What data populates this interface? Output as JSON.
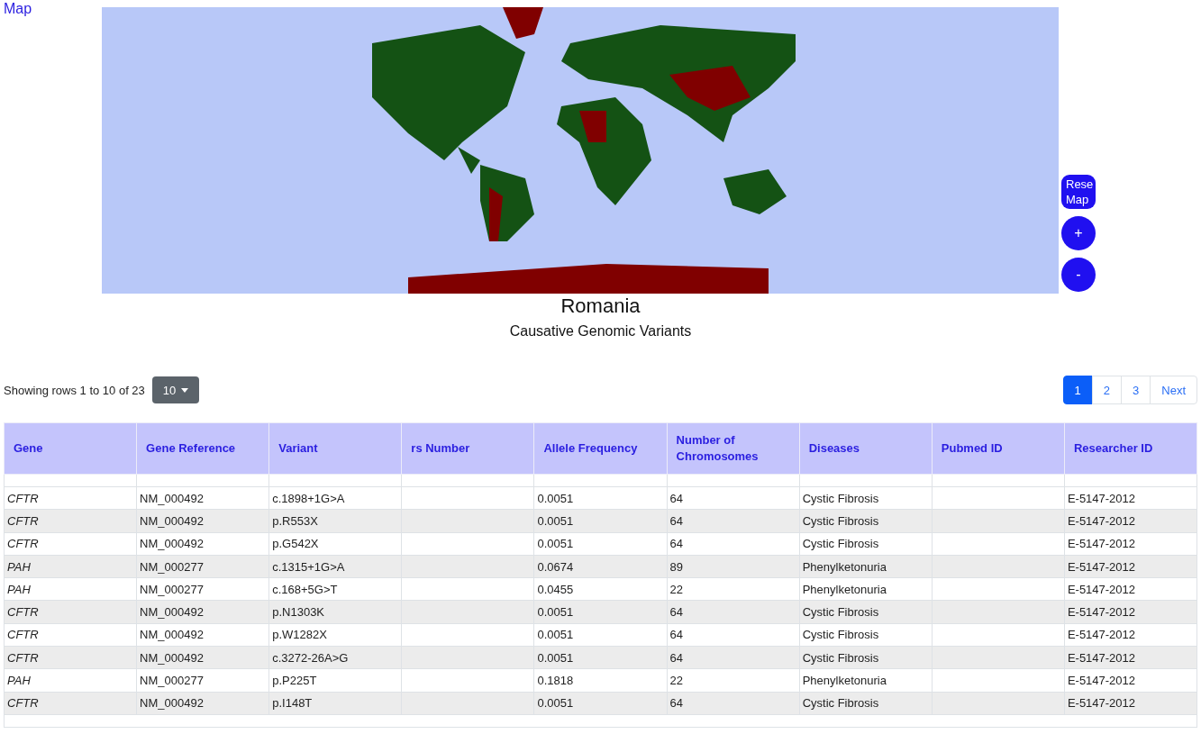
{
  "header": {
    "link": "Map"
  },
  "map": {
    "controls": [
      {
        "kind": "text",
        "label": "Rese Map"
      },
      {
        "kind": "round",
        "label": "+"
      },
      {
        "kind": "round",
        "label": "-"
      }
    ]
  },
  "title": "Romania",
  "subtitle": "Causative Genomic Variants",
  "toolbar": {
    "summary": "Showing rows 1 to 10 of 23",
    "page_size": "10"
  },
  "pagination": [
    {
      "label": "1",
      "selected": true
    },
    {
      "label": "2",
      "selected": false
    },
    {
      "label": "3",
      "selected": false
    },
    {
      "label": "Next",
      "selected": false
    }
  ],
  "table": {
    "columns": [
      {
        "label": "Gene",
        "kind": "gene"
      },
      {
        "label": "Gene Reference",
        "kind": "text"
      },
      {
        "label": "Variant",
        "kind": "text"
      },
      {
        "label": "rs Number",
        "kind": "text"
      },
      {
        "label": "Allele Frequency",
        "kind": "text"
      },
      {
        "label": "Number of Chromosomes",
        "kind": "text"
      },
      {
        "label": "Diseases",
        "kind": "text"
      },
      {
        "label": "Pubmed ID",
        "kind": "text"
      },
      {
        "label": "Researcher ID",
        "kind": "text"
      }
    ],
    "rows": [
      [
        "CFTR",
        "NM_000492",
        "c.1898+1G>A",
        "",
        "0.0051",
        "64",
        "Cystic Fibrosis",
        "",
        "E-5147-2012"
      ],
      [
        "CFTR",
        "NM_000492",
        "p.R553X",
        "",
        "0.0051",
        "64",
        "Cystic Fibrosis",
        "",
        "E-5147-2012"
      ],
      [
        "CFTR",
        "NM_000492",
        "p.G542X",
        "",
        "0.0051",
        "64",
        "Cystic Fibrosis",
        "",
        "E-5147-2012"
      ],
      [
        "PAH",
        "NM_000277",
        "c.1315+1G>A",
        "",
        "0.0674",
        "89",
        "Phenylketonuria",
        "",
        "E-5147-2012"
      ],
      [
        "PAH",
        "NM_000277",
        "c.168+5G>T",
        "",
        "0.0455",
        "22",
        "Phenylketonuria",
        "",
        "E-5147-2012"
      ],
      [
        "CFTR",
        "NM_000492",
        "p.N1303K",
        "",
        "0.0051",
        "64",
        "Cystic Fibrosis",
        "",
        "E-5147-2012"
      ],
      [
        "CFTR",
        "NM_000492",
        "p.W1282X",
        "",
        "0.0051",
        "64",
        "Cystic Fibrosis",
        "",
        "E-5147-2012"
      ],
      [
        "CFTR",
        "NM_000492",
        "c.3272-26A>G",
        "",
        "0.0051",
        "64",
        "Cystic Fibrosis",
        "",
        "E-5147-2012"
      ],
      [
        "PAH",
        "NM_000277",
        "p.P225T",
        "",
        "0.1818",
        "22",
        "Phenylketonuria",
        "",
        "E-5147-2012"
      ],
      [
        "CFTR",
        "NM_000492",
        "p.I148T",
        "",
        "0.0051",
        "64",
        "Cystic Fibrosis",
        "",
        "E-5147-2012"
      ]
    ]
  }
}
